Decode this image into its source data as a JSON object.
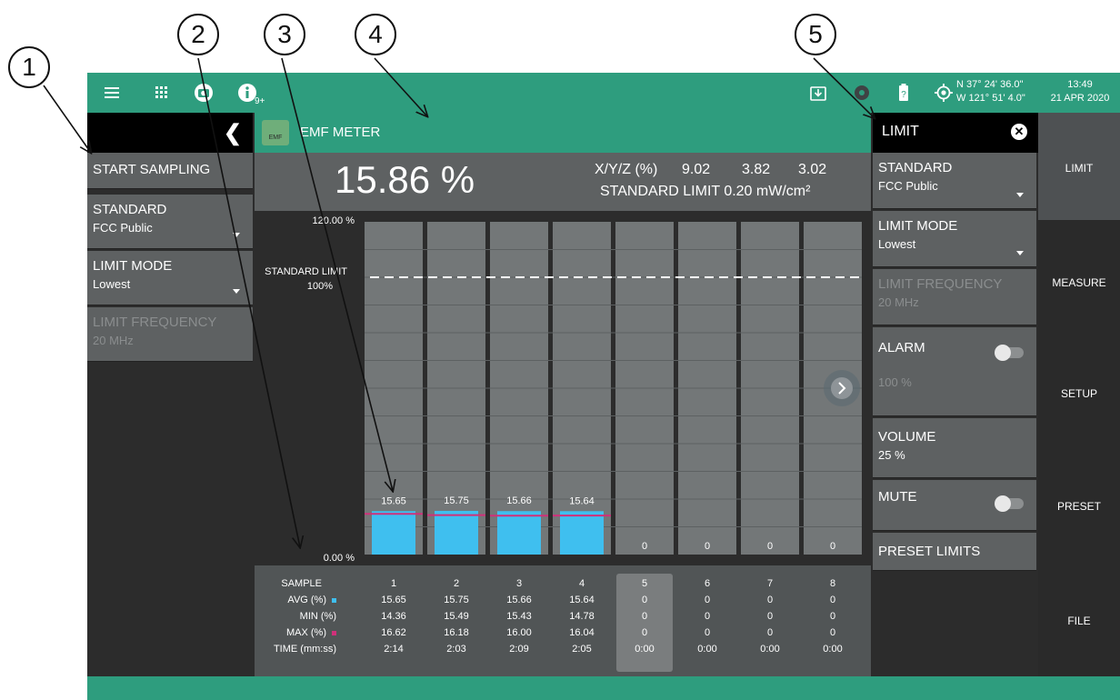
{
  "callouts": [
    "1",
    "2",
    "3",
    "4",
    "5"
  ],
  "topbar": {
    "icons": [
      "menu-icon",
      "apps-grid-icon",
      "camera-icon",
      "info-icon",
      "download-icon",
      "gps-satellite-icon",
      "battery-icon",
      "gps-target-icon"
    ],
    "info_badge": "9+",
    "battery_label": "?",
    "gps_lat": "N 37° 24' 36.0\"",
    "gps_lon": "W 121° 51' 4.0\"",
    "time": "13:49",
    "date": "21 APR 2020"
  },
  "left_panel": {
    "start_sampling": "START SAMPLING",
    "standard_title": "STANDARD",
    "standard_value": "FCC Public",
    "limit_mode_title": "LIMIT MODE",
    "limit_mode_value": "Lowest",
    "limit_freq_title": "LIMIT FREQUENCY",
    "limit_freq_value": "20 MHz"
  },
  "center": {
    "title": "EMF METER",
    "logo_text": "EMF",
    "reading": "15.86 %",
    "xyz_label": "X/Y/Z (%)",
    "x_val": "9.02",
    "y_val": "3.82",
    "z_val": "3.02",
    "standard_limit_text": "STANDARD LIMIT 0.20 mW/cm²"
  },
  "chart_data": {
    "type": "bar",
    "categories": [
      "1",
      "2",
      "3",
      "4",
      "5",
      "6",
      "7",
      "8"
    ],
    "values": [
      15.65,
      15.75,
      15.66,
      15.64,
      0,
      0,
      0,
      0
    ],
    "value_labels": [
      "15.65",
      "15.75",
      "15.66",
      "15.64",
      "0",
      "0",
      "0",
      "0"
    ],
    "ylim": [
      0,
      120
    ],
    "ymax_label": "120.00 %",
    "ymin_label": "0.00 %",
    "limit_value": 100,
    "limit_label_1": "STANDARD LIMIT",
    "limit_label_2": "100%",
    "bar_color": "#3fbfef",
    "max_marker_color": "#d0307a",
    "max_values": [
      16.62,
      16.18,
      16.0,
      16.04,
      0,
      0,
      0,
      0
    ]
  },
  "table": {
    "labels": [
      "SAMPLE",
      "AVG (%)",
      "MIN (%)",
      "MAX (%)",
      "TIME (mm:ss)"
    ],
    "rows": [
      [
        "1",
        "2",
        "3",
        "4",
        "5",
        "6",
        "7",
        "8"
      ],
      [
        "15.65",
        "15.75",
        "15.66",
        "15.64",
        "0",
        "0",
        "0",
        "0"
      ],
      [
        "14.36",
        "15.49",
        "15.43",
        "14.78",
        "0",
        "0",
        "0",
        "0"
      ],
      [
        "16.62",
        "16.18",
        "16.00",
        "16.04",
        "0",
        "0",
        "0",
        "0"
      ],
      [
        "2:14",
        "2:03",
        "2:09",
        "2:05",
        "0:00",
        "0:00",
        "0:00",
        "0:00"
      ]
    ],
    "selected_sample": "5"
  },
  "right_panel": {
    "title": "LIMIT",
    "standard_title": "STANDARD",
    "standard_value": "FCC Public",
    "limit_mode_title": "LIMIT MODE",
    "limit_mode_value": "Lowest",
    "limit_freq_title": "LIMIT FREQUENCY",
    "limit_freq_value": "20 MHz",
    "alarm_title": "ALARM",
    "alarm_value": "100 %",
    "volume_title": "VOLUME",
    "volume_value": "25 %",
    "mute_title": "MUTE",
    "preset_limits": "PRESET LIMITS"
  },
  "side_tabs": [
    "LIMIT",
    "MEASURE",
    "SETUP",
    "PRESET",
    "FILE"
  ]
}
